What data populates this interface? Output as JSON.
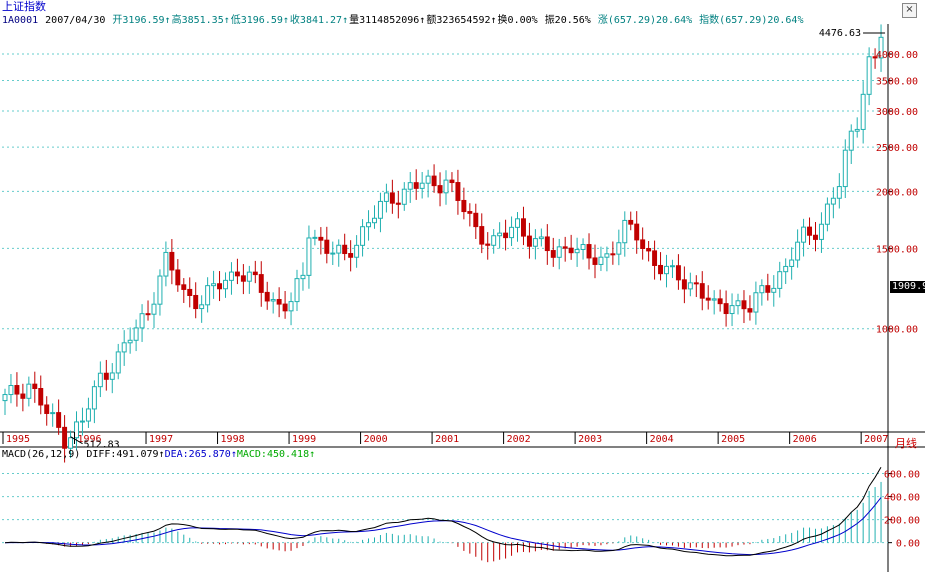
{
  "window": {
    "title": "上证指数",
    "close_glyph": "×"
  },
  "quote": {
    "code": "1A0001",
    "date": "2007/04/30",
    "open": "开3196.59↑",
    "high": "高3851.35↑",
    "low": "低3196.59↑",
    "close": "收3841.27↑",
    "volume": "量3114852096↑",
    "amount": "额323654592↑",
    "turnover": "换0.00%",
    "amplitude": "振20.56%",
    "change": "涨(657.29)20.64%",
    "index": "指数(657.29)20.64%"
  },
  "period_label": "月线",
  "current_price_tag": "1909.9",
  "colors": {
    "up": "#20b0b0",
    "down": "#c00000",
    "grid": "#66cccc",
    "axis_text": "#c00000",
    "year_text": "#c00000",
    "diff": "#000000",
    "dea": "#0000cc",
    "macd_pos": "#20b0b0",
    "macd_neg": "#c00000"
  },
  "macd": {
    "label": "MACD(26,12,9)",
    "diff": "DIFF:491.079↑",
    "dea": "DEA:265.870↑",
    "macd": "MACD:450.418↑"
  },
  "chart_data": [
    {
      "type": "candlestick",
      "title": "上证指数",
      "ylim": [
        600,
        4560
      ],
      "y_ticks": [
        {
          "value": 1000,
          "label": "1000.00"
        },
        {
          "value": 1500,
          "label": "1500.00"
        },
        {
          "value": 2000,
          "label": "2000.00"
        },
        {
          "value": 2500,
          "label": "2500.00"
        },
        {
          "value": 3000,
          "label": "3000.00"
        },
        {
          "value": 3500,
          "label": "3500.00"
        },
        {
          "value": 4000,
          "label": "4000.00"
        }
      ],
      "x_labels": [
        "1995",
        "1996",
        "1997",
        "1998",
        "1999",
        "2000",
        "2001",
        "2002",
        "2003",
        "2004",
        "2005",
        "2006",
        "2007"
      ],
      "annotations": [
        {
          "label": "512.83",
          "value": 512.83
        },
        {
          "label": "4476.63",
          "value": 4476.63
        }
      ],
      "anchors": [
        {
          "month": 0,
          "price": 700
        },
        {
          "month": 4,
          "price": 760
        },
        {
          "month": 7,
          "price": 650
        },
        {
          "month": 10,
          "price": 580
        },
        {
          "month": 13,
          "price": 620
        },
        {
          "month": 16,
          "price": 780
        },
        {
          "month": 20,
          "price": 900
        },
        {
          "month": 24,
          "price": 1100
        },
        {
          "month": 27,
          "price": 1400
        },
        {
          "month": 30,
          "price": 1200
        },
        {
          "month": 33,
          "price": 1150
        },
        {
          "month": 36,
          "price": 1250
        },
        {
          "month": 39,
          "price": 1350
        },
        {
          "month": 42,
          "price": 1250
        },
        {
          "month": 45,
          "price": 1150
        },
        {
          "month": 48,
          "price": 1130
        },
        {
          "month": 50,
          "price": 1300
        },
        {
          "month": 51,
          "price": 1650
        },
        {
          "month": 54,
          "price": 1500
        },
        {
          "month": 57,
          "price": 1420
        },
        {
          "month": 60,
          "price": 1650
        },
        {
          "month": 64,
          "price": 1900
        },
        {
          "month": 68,
          "price": 2050
        },
        {
          "month": 72,
          "price": 2070
        },
        {
          "month": 74,
          "price": 2150
        },
        {
          "month": 76,
          "price": 1900
        },
        {
          "month": 79,
          "price": 1650
        },
        {
          "month": 82,
          "price": 1550
        },
        {
          "month": 84,
          "price": 1600
        },
        {
          "month": 86,
          "price": 1700
        },
        {
          "month": 89,
          "price": 1550
        },
        {
          "month": 92,
          "price": 1450
        },
        {
          "month": 95,
          "price": 1550
        },
        {
          "month": 98,
          "price": 1400
        },
        {
          "month": 101,
          "price": 1450
        },
        {
          "month": 104,
          "price": 1650
        },
        {
          "month": 106,
          "price": 1600
        },
        {
          "month": 109,
          "price": 1400
        },
        {
          "month": 112,
          "price": 1300
        },
        {
          "month": 116,
          "price": 1250
        },
        {
          "month": 119,
          "price": 1100
        },
        {
          "month": 122,
          "price": 1150
        },
        {
          "month": 125,
          "price": 1100
        },
        {
          "month": 128,
          "price": 1250
        },
        {
          "month": 131,
          "price": 1350
        },
        {
          "month": 134,
          "price": 1600
        },
        {
          "month": 137,
          "price": 1700
        },
        {
          "month": 140,
          "price": 2050
        },
        {
          "month": 142,
          "price": 2700
        },
        {
          "month": 143,
          "price": 2900
        },
        {
          "month": 145,
          "price": 3800
        },
        {
          "month": 146,
          "price": 3841
        },
        {
          "month": 147,
          "price": 4400
        }
      ]
    },
    {
      "type": "macd",
      "ylim": [
        -220,
        700
      ],
      "y_ticks": [
        {
          "value": 0,
          "label": "0.00"
        },
        {
          "value": 200,
          "label": "200.00"
        },
        {
          "value": 400,
          "label": "400.00"
        },
        {
          "value": 600,
          "label": "600.00"
        }
      ]
    }
  ]
}
